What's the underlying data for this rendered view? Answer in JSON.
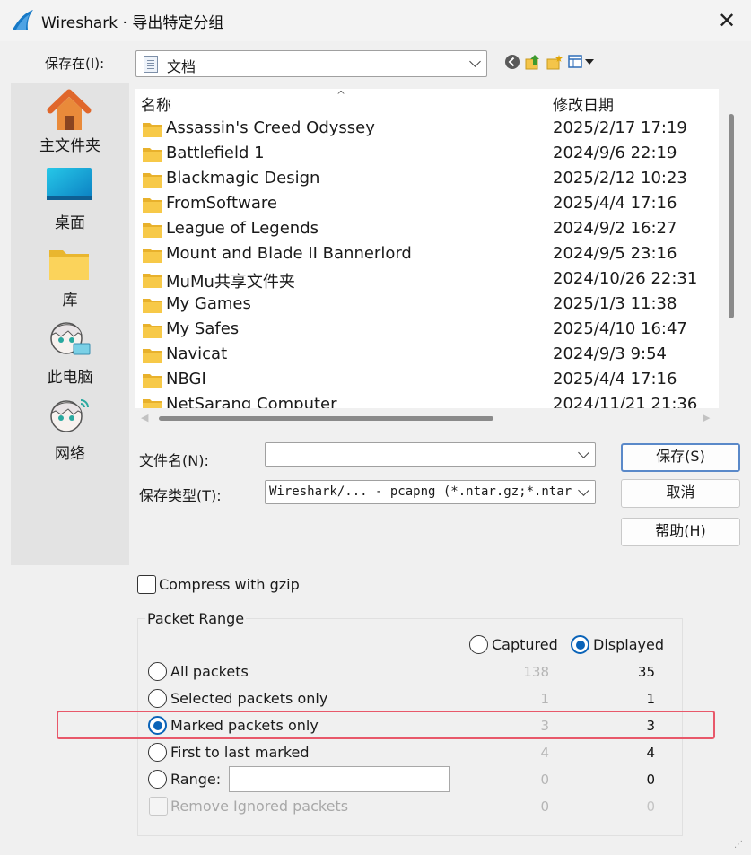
{
  "window": {
    "title": "Wireshark · 导出特定分组"
  },
  "toolbar": {
    "save_in_label": "保存在(I):",
    "location_value": "文档",
    "back_icon": "back-arrow-icon",
    "up_icon": "up-folder-icon",
    "new_folder_icon": "new-folder-icon",
    "view_icon": "view-menu-icon"
  },
  "places": [
    {
      "label": "主文件夹",
      "icon": "home-icon"
    },
    {
      "label": "桌面",
      "icon": "desktop-icon"
    },
    {
      "label": "库",
      "icon": "library-folder-icon"
    },
    {
      "label": "此电脑",
      "icon": "this-pc-avatar-icon"
    },
    {
      "label": "网络",
      "icon": "network-avatar-icon"
    }
  ],
  "file_list": {
    "headers": {
      "name": "名称",
      "modified": "修改日期"
    },
    "rows": [
      {
        "name": "Assassin's Creed Odyssey",
        "modified": "2025/2/17 17:19"
      },
      {
        "name": "Battlefield 1",
        "modified": "2024/9/6 22:19"
      },
      {
        "name": "Blackmagic Design",
        "modified": "2025/2/12 10:23"
      },
      {
        "name": "FromSoftware",
        "modified": "2025/4/4 17:16"
      },
      {
        "name": "League of Legends",
        "modified": "2024/9/2 16:27"
      },
      {
        "name": "Mount and Blade II Bannerlord",
        "modified": "2024/9/5 23:16"
      },
      {
        "name": "MuMu共享文件夹",
        "modified": "2024/10/26 22:31"
      },
      {
        "name": "My Games",
        "modified": "2025/1/3 11:38"
      },
      {
        "name": "My Safes",
        "modified": "2025/4/10 16:47"
      },
      {
        "name": "Navicat",
        "modified": "2024/9/3 9:54"
      },
      {
        "name": "NBGI",
        "modified": "2025/4/4 17:16"
      },
      {
        "name": "NetSarang Computer",
        "modified": "2024/11/21 21:36"
      }
    ]
  },
  "form": {
    "file_name_label": "文件名(N):",
    "file_name_value": "",
    "file_type_label": "保存类型(T):",
    "file_type_value": "Wireshark/... - pcapng (*.ntar.gz;*.ntar.zst;*.ntar;*.pcapng.gz)"
  },
  "buttons": {
    "save": "保存(S)",
    "cancel": "取消",
    "help": "帮助(H)"
  },
  "compress": {
    "label": "Compress with gzip",
    "checked": false
  },
  "packet_range": {
    "title": "Packet Range",
    "captured_label": "Captured",
    "displayed_label": "Displayed",
    "selected_column": "Displayed",
    "rows": [
      {
        "label": "All packets",
        "captured": "138",
        "displayed": "35",
        "selected": false
      },
      {
        "label": "Selected packets only",
        "captured": "1",
        "displayed": "1",
        "selected": false
      },
      {
        "label": "Marked packets only",
        "captured": "3",
        "displayed": "3",
        "selected": true
      },
      {
        "label": "First to last marked",
        "captured": "4",
        "displayed": "4",
        "selected": false
      },
      {
        "label": "Range:",
        "captured": "0",
        "displayed": "0",
        "selected": false,
        "input_value": ""
      },
      {
        "label": "Remove Ignored packets",
        "captured": "0",
        "displayed": "0",
        "disabled": true
      }
    ]
  },
  "colors": {
    "accent": "#0a63b8",
    "highlight_border": "#e8586a",
    "folder": "#f5c543"
  }
}
